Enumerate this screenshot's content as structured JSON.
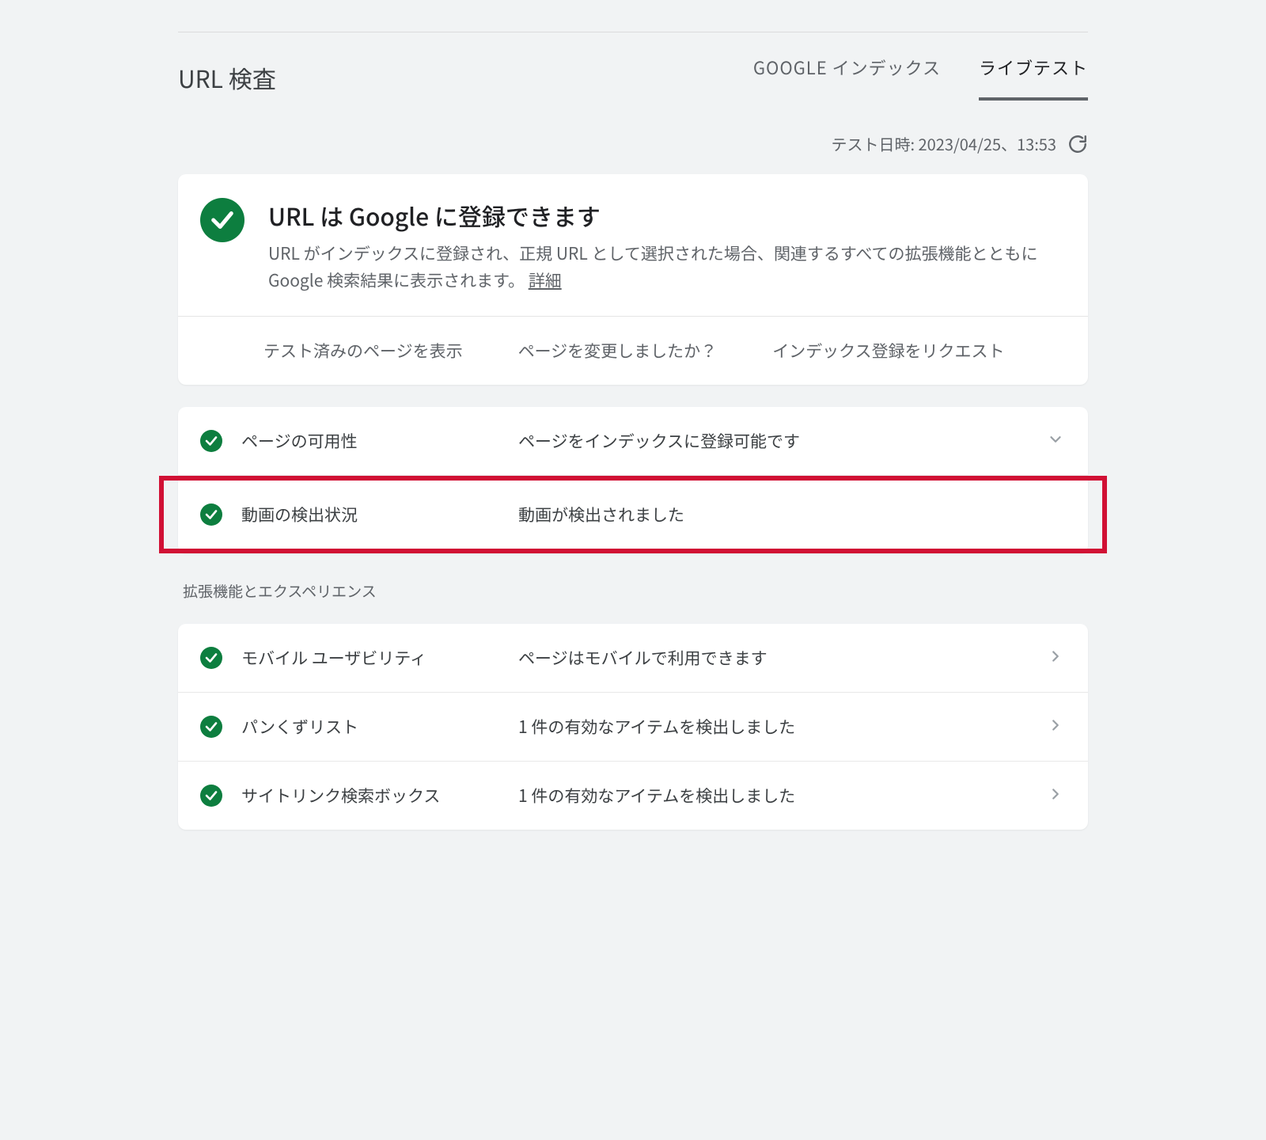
{
  "header": {
    "title": "URL 検査",
    "tabs": {
      "google_index": "GOOGLE インデックス",
      "live_test": "ライブテスト"
    }
  },
  "test_time": {
    "label": "テスト日時: 2023/04/25、13:53"
  },
  "main": {
    "title": "URL は Google に登録できます",
    "description_prefix": "URL がインデックスに登録され、正規 URL として選択された場合、関連するすべての拡張機能とともに Google 検索結果に表示されます。",
    "detail_link": "詳細",
    "actions": {
      "view_tested": "テスト済みのページを表示",
      "page_changed": "ページを変更しましたか？",
      "request_index": "インデックス登録をリクエスト"
    }
  },
  "availability_rows": [
    {
      "label": "ページの可用性",
      "status": "ページをインデックスに登録可能です",
      "chevron": "down"
    },
    {
      "label": "動画の検出状況",
      "status": "動画が検出されました",
      "chevron": "none"
    }
  ],
  "ext_heading": "拡張機能とエクスペリエンス",
  "ext_rows": [
    {
      "label": "モバイル ユーザビリティ",
      "status": "ページはモバイルで利用できます"
    },
    {
      "label": "パンくずリスト",
      "status": "1 件の有効なアイテムを検出しました"
    },
    {
      "label": "サイトリンク検索ボックス",
      "status": "1 件の有効なアイテムを検出しました"
    }
  ]
}
